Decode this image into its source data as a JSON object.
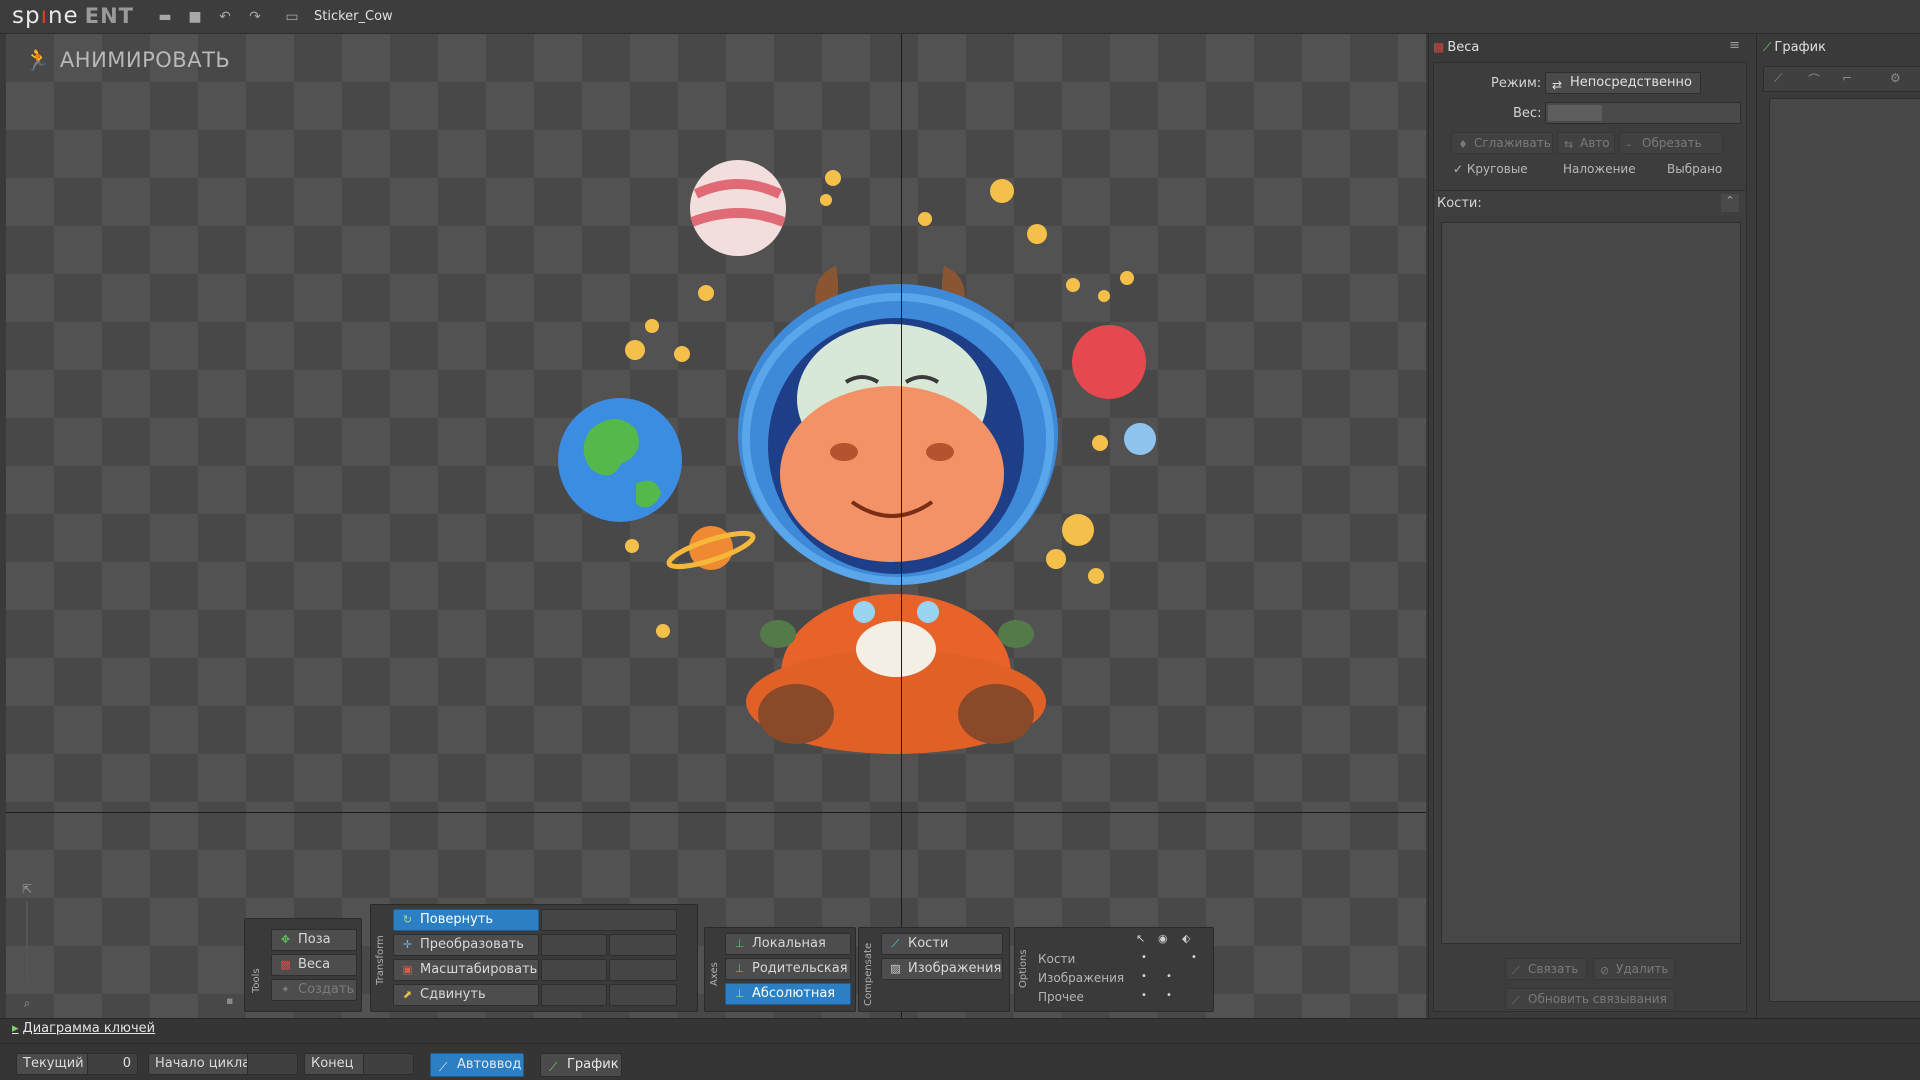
{
  "app": {
    "logo": "spine",
    "edition": "ENT",
    "project_name": "Sticker_Cow"
  },
  "viewport": {
    "mode_label": "АНИМИРОВАТЬ"
  },
  "tools": {
    "panel_label": "Tools",
    "pose": "Поза",
    "weights": "Веса",
    "create": "Создать"
  },
  "transform": {
    "panel_label": "Transform",
    "rotate": "Повернуть",
    "transform": "Преобразовать",
    "scale": "Масштабировать",
    "translate": "Сдвинуть"
  },
  "axes": {
    "panel_label": "Axes",
    "local": "Локальная",
    "parent": "Родительская",
    "absolute": "Абсолютная"
  },
  "compensate": {
    "panel_label": "Compensate",
    "bones": "Кости",
    "images": "Изображения"
  },
  "options": {
    "panel_label": "Options",
    "rows": [
      "Кости",
      "Изображения",
      "Прочее"
    ]
  },
  "weights_panel": {
    "tab": "Веса",
    "mode_label": "Режим:",
    "mode_value": "Непосредственно",
    "weight_label": "Вес:",
    "smooth": "Сглаживать",
    "auto": "Авто",
    "prune": "Обрезать",
    "circular": "Круговые",
    "overlay": "Наложение",
    "selected": "Выбрано",
    "bones_label": "Кости:",
    "bind": "Связать",
    "remove": "Удалить",
    "update_bindings": "Обновить связывания"
  },
  "graph_panel": {
    "tab": "График"
  },
  "bottom": {
    "dopesheet_tab": "Диаграмма ключей",
    "current_label": "Текущий",
    "current_value": "0",
    "loop_start": "Начало цикла",
    "end": "Конец",
    "autokey": "Автоввод",
    "graph": "График"
  },
  "colors": {
    "accent": "#2b7fc2",
    "panel": "#3a3a3a",
    "checker_dark": "#484848",
    "checker_light": "#525252"
  }
}
